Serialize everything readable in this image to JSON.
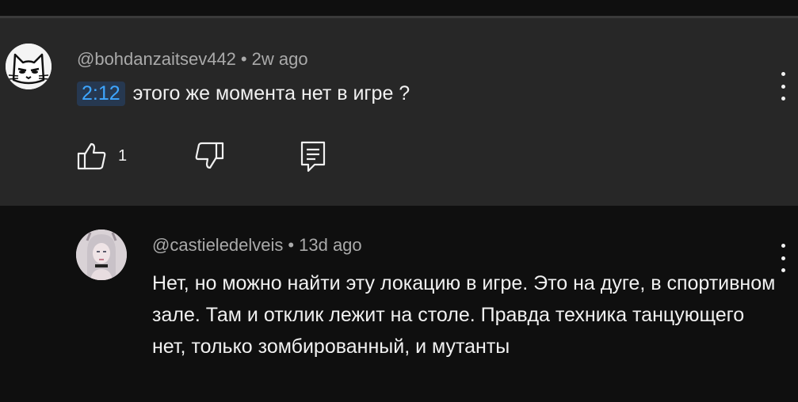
{
  "comment": {
    "author": "@bohdanzaitsev442",
    "time": "2w ago",
    "separator": "•",
    "timestamp_link": "2:12",
    "text": "этого же момента нет в игре ?",
    "likes": "1",
    "icons": {
      "avatar": "cat-avatar",
      "like": "thumbs-up-icon",
      "dislike": "thumbs-down-icon",
      "reply": "reply-comment-icon",
      "menu": "kebab-menu-icon"
    }
  },
  "reply": {
    "author": "@castieledelveis",
    "time": "13d ago",
    "separator": "•",
    "text": "Нет, но можно найти эту локацию в игре. Это на дуге, в спортивном зале. Там и отклик лежит на столе. Правда техника танцующего нет, только зомбированный, и мутанты",
    "icons": {
      "avatar": "girl-avatar",
      "menu": "kebab-menu-icon"
    }
  },
  "colors": {
    "background": "#0f0f0f",
    "highlight_bg": "#272727",
    "text": "#f1f1f1",
    "meta_text": "#aaaaaa",
    "link": "#3ea6ff",
    "link_bg": "#263850"
  }
}
